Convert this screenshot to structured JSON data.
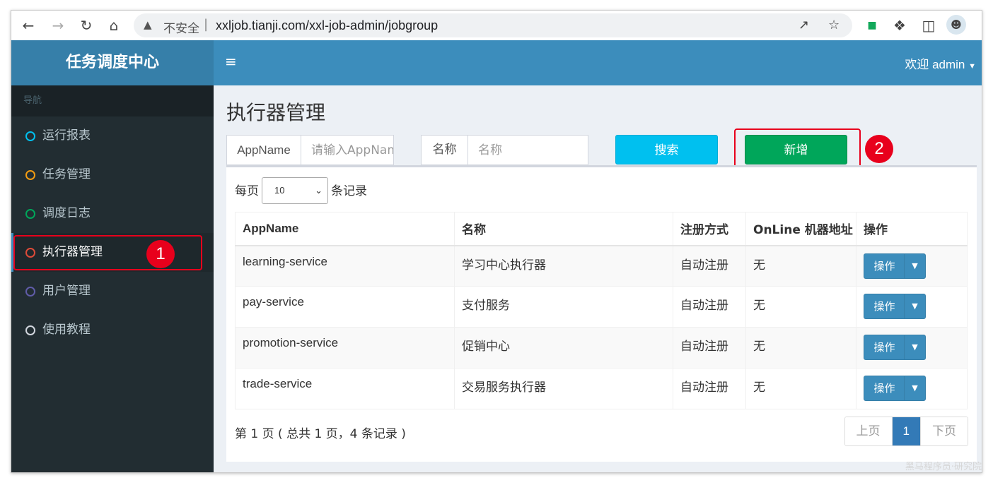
{
  "browser": {
    "insecure_label": "不安全",
    "separator": "|",
    "url": "xxljob.tianji.com/xxl-job-admin/jobgroup"
  },
  "app": {
    "brand": "任务调度中心",
    "menu_icon": "≡",
    "welcome": "欢迎 admin"
  },
  "sidebar": {
    "header": "导航",
    "items": [
      {
        "label": "运行报表",
        "color": "#00c0ef"
      },
      {
        "label": "任务管理",
        "color": "#f39c12"
      },
      {
        "label": "调度日志",
        "color": "#00a65a"
      },
      {
        "label": "执行器管理",
        "color": "#dd4b39"
      },
      {
        "label": "用户管理",
        "color": "#605ca8"
      },
      {
        "label": "使用教程",
        "color": "#d2d6de"
      }
    ],
    "active_index": 3
  },
  "page": {
    "title": "执行器管理",
    "filters": {
      "appname_label": "AppName",
      "appname_placeholder": "请输入AppName",
      "name_label": "名称",
      "name_placeholder": "名称"
    },
    "search_button": "搜索",
    "add_button": "新增",
    "per_page_prefix": "每页",
    "per_page_value": "10",
    "per_page_suffix": "条记录",
    "table": {
      "columns": [
        "AppName",
        "名称",
        "注册方式",
        "OnLine 机器地址",
        "操作"
      ],
      "rows": [
        {
          "appname": "learning-service",
          "name": "学习中心执行器",
          "reg": "自动注册",
          "online": "无",
          "op": "操作"
        },
        {
          "appname": "pay-service",
          "name": "支付服务",
          "reg": "自动注册",
          "online": "无",
          "op": "操作"
        },
        {
          "appname": "promotion-service",
          "name": "促销中心",
          "reg": "自动注册",
          "online": "无",
          "op": "操作"
        },
        {
          "appname": "trade-service",
          "name": "交易服务执行器",
          "reg": "自动注册",
          "online": "无",
          "op": "操作"
        }
      ]
    },
    "summary": "第 1 页 ( 总共 1 页，4 条记录 )",
    "pager": {
      "prev": "上页",
      "current": "1",
      "next": "下页"
    }
  },
  "annotations": [
    "1",
    "2"
  ],
  "watermark": "黑马程序员·研究院",
  "colors": {
    "search_button": "#00c0ef",
    "add_button": "#00a65a",
    "annotation": "#e8001c",
    "header": "#3c8dbc"
  }
}
